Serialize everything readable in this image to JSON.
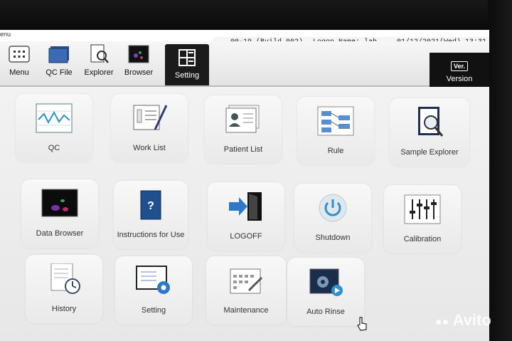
{
  "menu_fragment": "enu",
  "status": {
    "build": "00-19 (Build 002)",
    "logon": "Logon Name: lab",
    "datetime": "01/12/2021(Wed) 13:31"
  },
  "toolbar": {
    "items": [
      {
        "label": "Menu",
        "icon": "menu-grid-icon"
      },
      {
        "label": "QC File",
        "icon": "qc-file-icon"
      },
      {
        "label": "Explorer",
        "icon": "explorer-icon"
      },
      {
        "label": "Browser",
        "icon": "browser-icon"
      },
      {
        "label": "Setting",
        "icon": "setting-icon"
      }
    ],
    "active": "Setting",
    "version_badge": "Ver.",
    "version_label": "Version"
  },
  "tiles": [
    {
      "label": "QC",
      "icon": "qc-chart-icon"
    },
    {
      "label": "Work List",
      "icon": "work-list-icon"
    },
    {
      "label": "Patient List",
      "icon": "patient-list-icon"
    },
    {
      "label": "Rule",
      "icon": "rule-icon"
    },
    {
      "label": "Sample Explorer",
      "icon": "sample-explorer-icon"
    },
    {
      "label": "Data Browser",
      "icon": "data-browser-icon"
    },
    {
      "label": "Instructions for Use",
      "icon": "instructions-book-icon"
    },
    {
      "label": "LOGOFF",
      "icon": "logoff-icon"
    },
    {
      "label": "Shutdown",
      "icon": "power-icon"
    },
    {
      "label": "Calibration",
      "icon": "calibration-sliders-icon"
    },
    {
      "label": "History",
      "icon": "history-icon"
    },
    {
      "label": "Setting",
      "icon": "setting-gear-icon"
    },
    {
      "label": "Maintenance",
      "icon": "maintenance-calendar-icon"
    },
    {
      "label": "Auto Rinse",
      "icon": "auto-rinse-icon"
    }
  ],
  "watermark": "Avito",
  "colors": {
    "accent_blue": "#2f78c8",
    "active_tab": "#1b1b1b"
  }
}
